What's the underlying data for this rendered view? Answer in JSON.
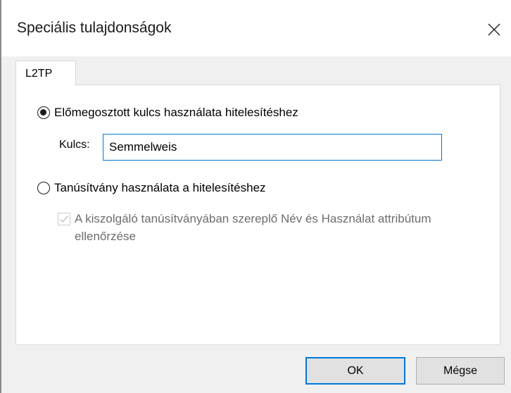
{
  "window": {
    "title": "Speciális tulajdonságok",
    "close_icon": "close-icon"
  },
  "tabs": [
    {
      "label": "L2TP",
      "selected": true
    }
  ],
  "options": {
    "psk": {
      "label": "Előmegosztott kulcs használata hitelesítéshez",
      "selected": true
    },
    "key": {
      "label": "Kulcs:",
      "value": "Semmelweis"
    },
    "cert": {
      "label": "Tanúsítvány használata a hitelesítéshez",
      "selected": false
    },
    "verify": {
      "label": "A kiszolgáló tanúsítványában szereplő Név és Használat attribútum ellenőrzése",
      "checked": true,
      "disabled": true
    }
  },
  "buttons": {
    "ok": "OK",
    "cancel": "Mégse"
  },
  "colors": {
    "accent": "#0078d7",
    "body_bg": "#f0f0f0",
    "disabled_text": "#6d6d6d"
  }
}
